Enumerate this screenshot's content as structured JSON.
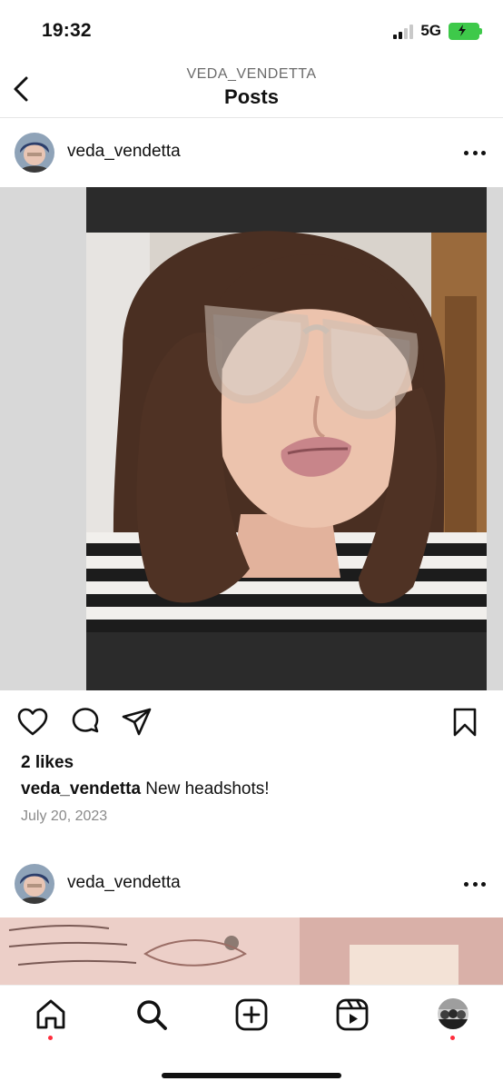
{
  "status_bar": {
    "time": "19:32",
    "network": "5G",
    "battery_charging": true
  },
  "header": {
    "subtitle": "VEDA_VENDETTA",
    "title": "Posts"
  },
  "posts": [
    {
      "username": "veda_vendetta",
      "likes": "2 likes",
      "caption_user": "veda_vendetta",
      "caption_text": " New headshots!",
      "date": "July 20, 2023"
    },
    {
      "username": "veda_vendetta"
    }
  ],
  "icons": {
    "back": "chevron-left-icon",
    "more": "more-horizontal-icon",
    "like": "heart-icon",
    "comment": "comment-icon",
    "share": "send-icon",
    "save": "bookmark-icon",
    "tabs": [
      "home-icon",
      "search-icon",
      "create-icon",
      "reels-icon",
      "profile-avatar"
    ]
  },
  "colors": {
    "notification_dot": "#ff2d3c",
    "battery": "#3ec94a"
  }
}
